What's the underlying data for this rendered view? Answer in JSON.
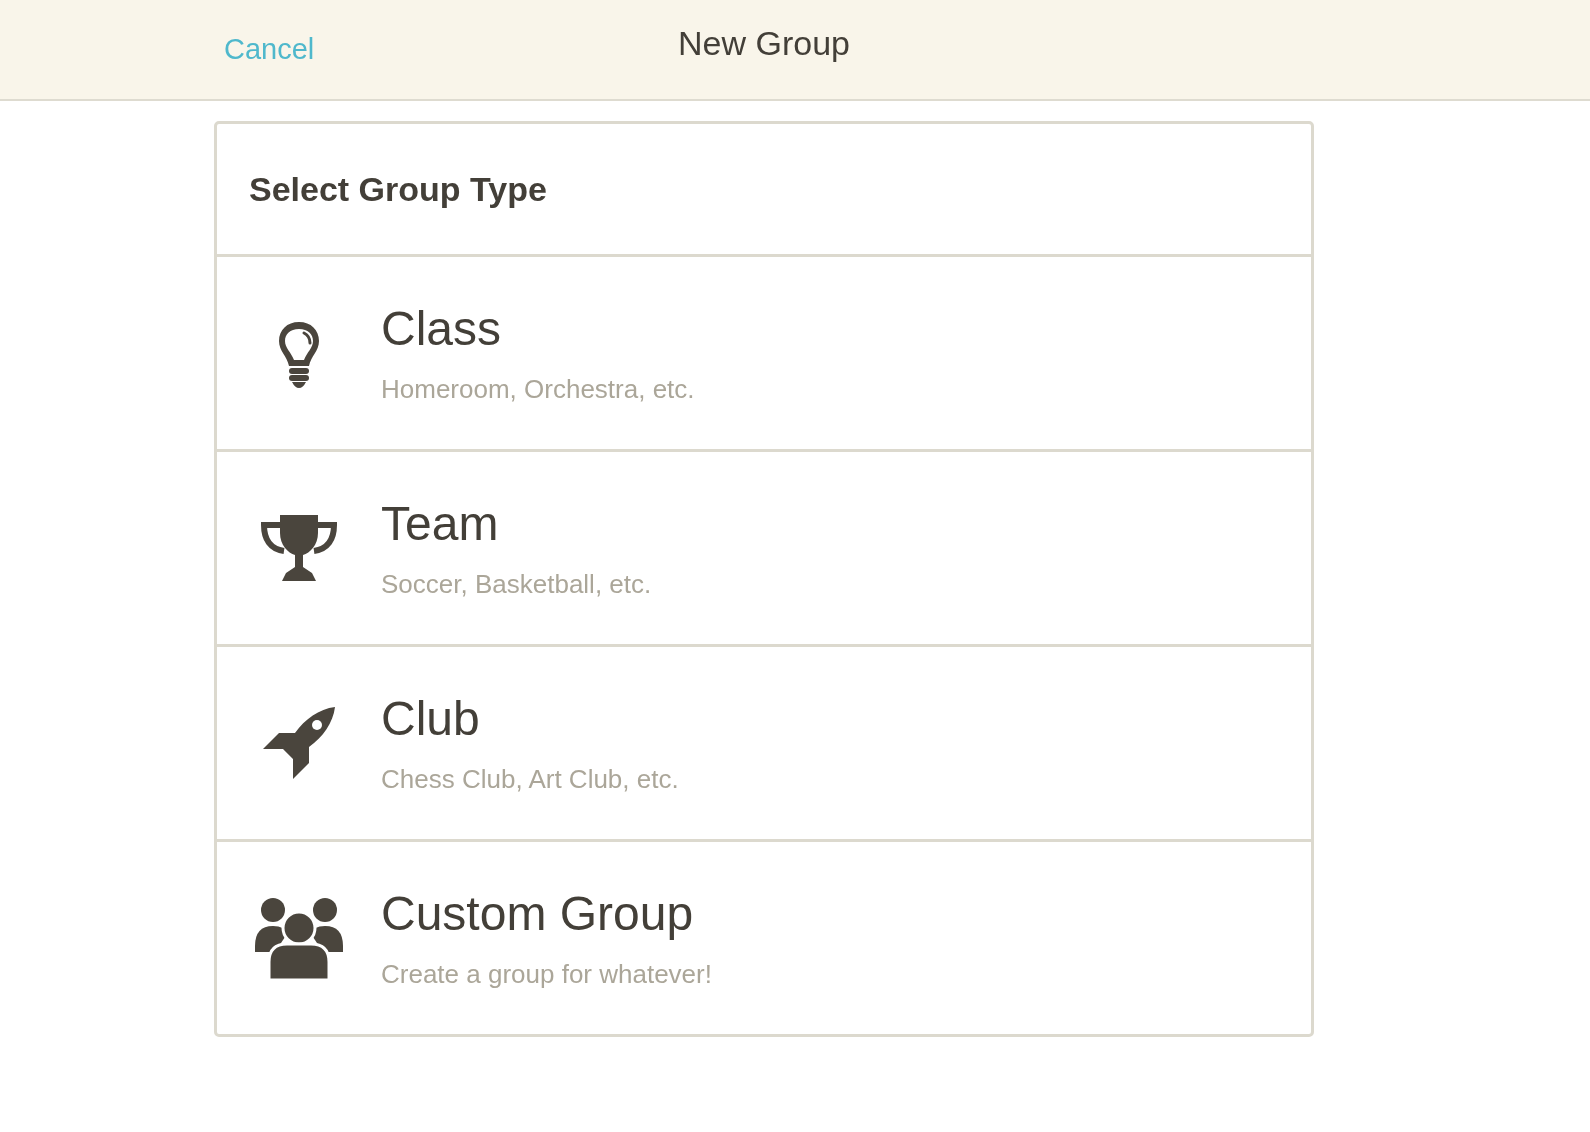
{
  "header": {
    "cancel": "Cancel",
    "title": "New Group"
  },
  "card": {
    "title": "Select Group Type",
    "options": [
      {
        "kind": "lightbulb",
        "name": "Class",
        "description": "Homeroom, Orchestra, etc."
      },
      {
        "kind": "trophy",
        "name": "Team",
        "description": "Soccer, Basketball, etc."
      },
      {
        "kind": "rocket",
        "name": "Club",
        "description": "Chess Club, Art Club, etc."
      },
      {
        "kind": "people",
        "name": "Custom Group",
        "description": "Create a group for whatever!"
      }
    ]
  }
}
